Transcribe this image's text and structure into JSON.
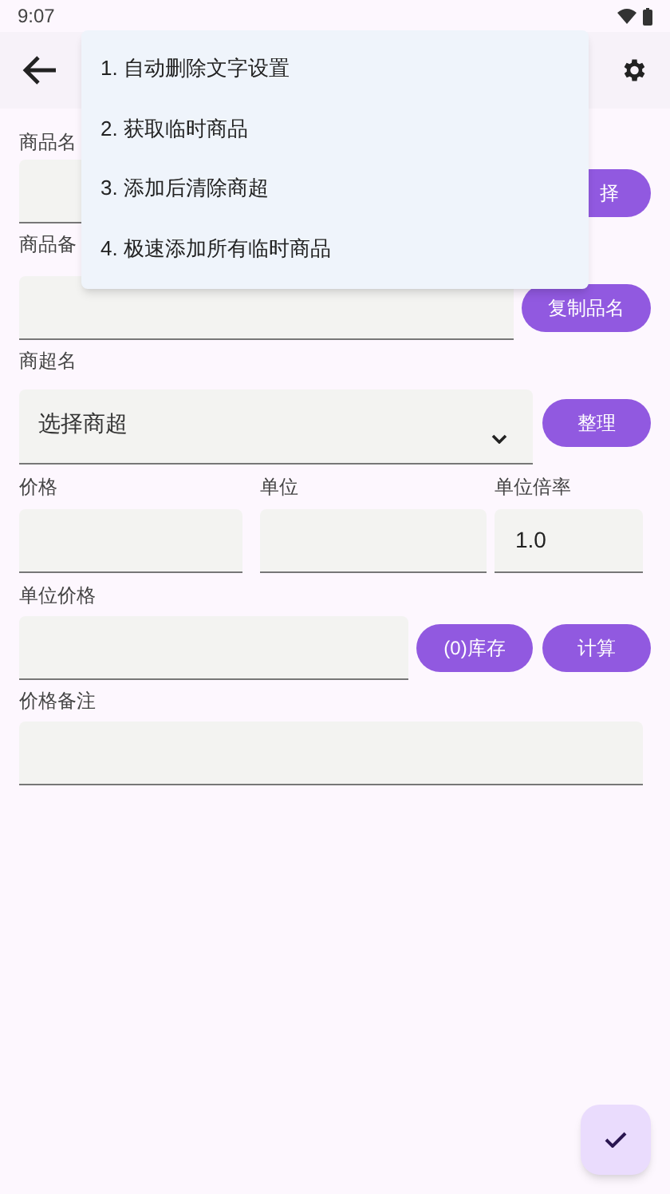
{
  "status_bar": {
    "time": "9:07"
  },
  "menu": {
    "items": [
      {
        "label": "1. 自动删除文字设置"
      },
      {
        "label": "2. 获取临时商品"
      },
      {
        "label": "3. 添加后清除商超"
      },
      {
        "label": "4. 极速添加所有临时商品"
      }
    ]
  },
  "form": {
    "product_name": {
      "label": "商品名",
      "button": "择"
    },
    "product_note": {
      "label": "商品备",
      "button": "复制品名"
    },
    "store": {
      "label": "商超名",
      "placeholder": "选择商超",
      "button": "整理"
    },
    "price": {
      "label": "价格"
    },
    "unit": {
      "label": "单位"
    },
    "unit_ratio": {
      "label": "单位倍率",
      "value": "1.0"
    },
    "unit_price": {
      "label": "单位价格",
      "buttons": [
        "(0)库存",
        "计算"
      ]
    },
    "price_note": {
      "label": "价格备注"
    }
  }
}
